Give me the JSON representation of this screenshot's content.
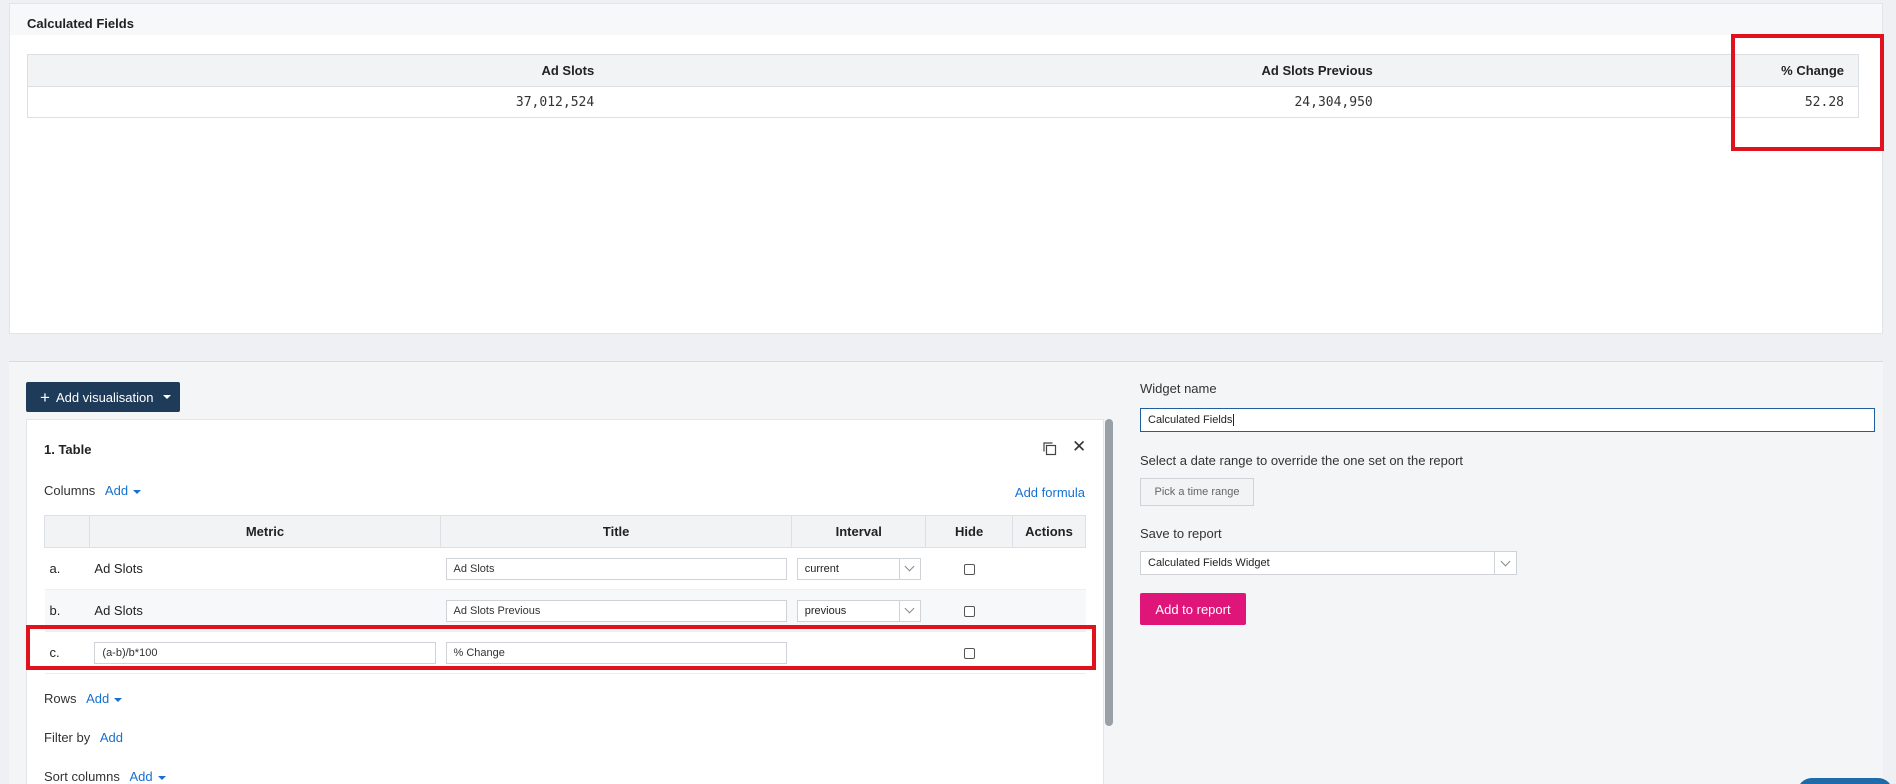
{
  "preview": {
    "title": "Calculated Fields",
    "headers": [
      "Ad Slots",
      "Ad Slots Previous",
      "% Change"
    ],
    "row": [
      "37,012,524",
      "24,304,950",
      "52.28"
    ]
  },
  "editor": {
    "add_visualisation_label": "Add visualisation",
    "card_title": "1. Table",
    "columns_label": "Columns",
    "add_label": "Add",
    "add_formula_label": "Add formula",
    "table_headers": [
      "",
      "Metric",
      "Title",
      "Interval",
      "Hide",
      "Actions"
    ],
    "rows": [
      {
        "index": "a.",
        "metric": "Ad Slots",
        "title": "Ad Slots",
        "interval": "current"
      },
      {
        "index": "b.",
        "metric": "Ad Slots",
        "title": "Ad Slots Previous",
        "interval": "previous"
      },
      {
        "index": "c.",
        "metric": "(a-b)/b*100",
        "title": "% Change",
        "interval": ""
      }
    ],
    "rows_label": "Rows",
    "filter_label": "Filter by",
    "sort_label": "Sort columns"
  },
  "sidebar": {
    "widget_name_label": "Widget name",
    "widget_name_value": "Calculated Fields",
    "date_range_label": "Select a date range to override the one set on the report",
    "pick_range_label": "Pick a time range",
    "save_to_report_label": "Save to report",
    "report_value": "Calculated Fields Widget",
    "add_to_report_label": "Add to report"
  },
  "colors": {
    "primary_navy": "#1f3b5a",
    "accent_pink": "#e0157a",
    "link_blue": "#1670d2",
    "highlight_red": "#e0121e"
  }
}
